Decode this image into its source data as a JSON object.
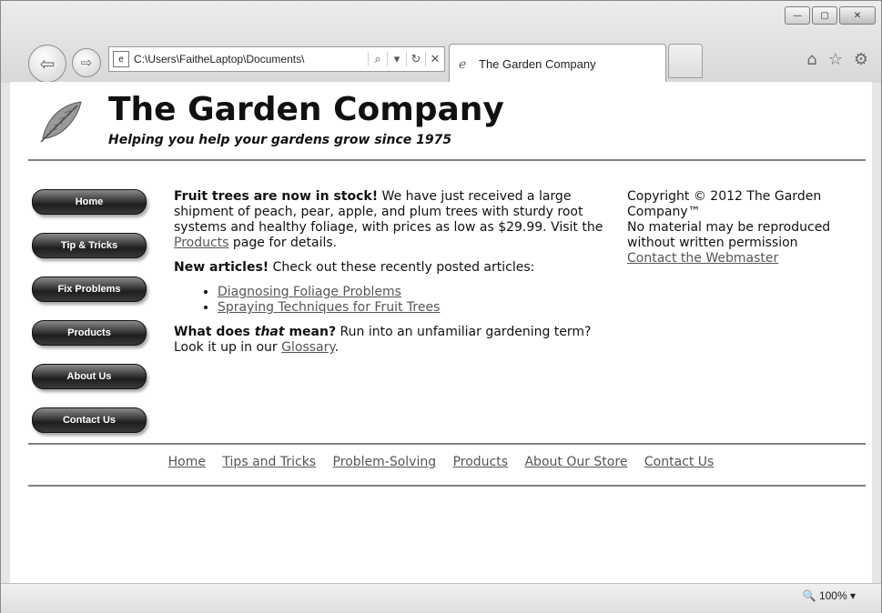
{
  "browser": {
    "address": "C:\\Users\\FaitheLaptop\\Documents\\",
    "tab_title": "The Garden Company",
    "zoom": "100%"
  },
  "header": {
    "title": "The Garden Company",
    "tagline": "Helping you help your gardens grow since 1975"
  },
  "menu": [
    "Home",
    "Tip & Tricks",
    "Fix Problems",
    "Products",
    "About Us",
    "Contact Us"
  ],
  "main": {
    "p1_bold": "Fruit trees are now in stock!",
    "p1_text": " We have just received a large shipment of peach, pear, apple, and plum trees with sturdy root systems and healthy foliage, with prices as low as $29.99. Visit the ",
    "p1_link": "Products",
    "p1_tail": " page for details.",
    "p2_bold": "New articles!",
    "p2_text": " Check out these recently posted articles:",
    "articles": [
      "Diagnosing Foliage Problems",
      "Spraying Techniques for Fruit Trees"
    ],
    "p3_bold_a": "What does ",
    "p3_bold_italic": "that",
    "p3_bold_b": " mean?",
    "p3_text": " Run into an unfamiliar gardening term? Look it up in our ",
    "p3_link": "Glossary",
    "p3_tail": "."
  },
  "sidebar": {
    "copyright": "Copyright © 2012 The Garden Company™",
    "notice": "No material may be reproduced without written permission",
    "contact_link": "Contact the Webmaster"
  },
  "footer": [
    "Home",
    "Tips and Tricks",
    "Problem-Solving",
    "Products",
    "About Our Store",
    "Contact Us"
  ]
}
